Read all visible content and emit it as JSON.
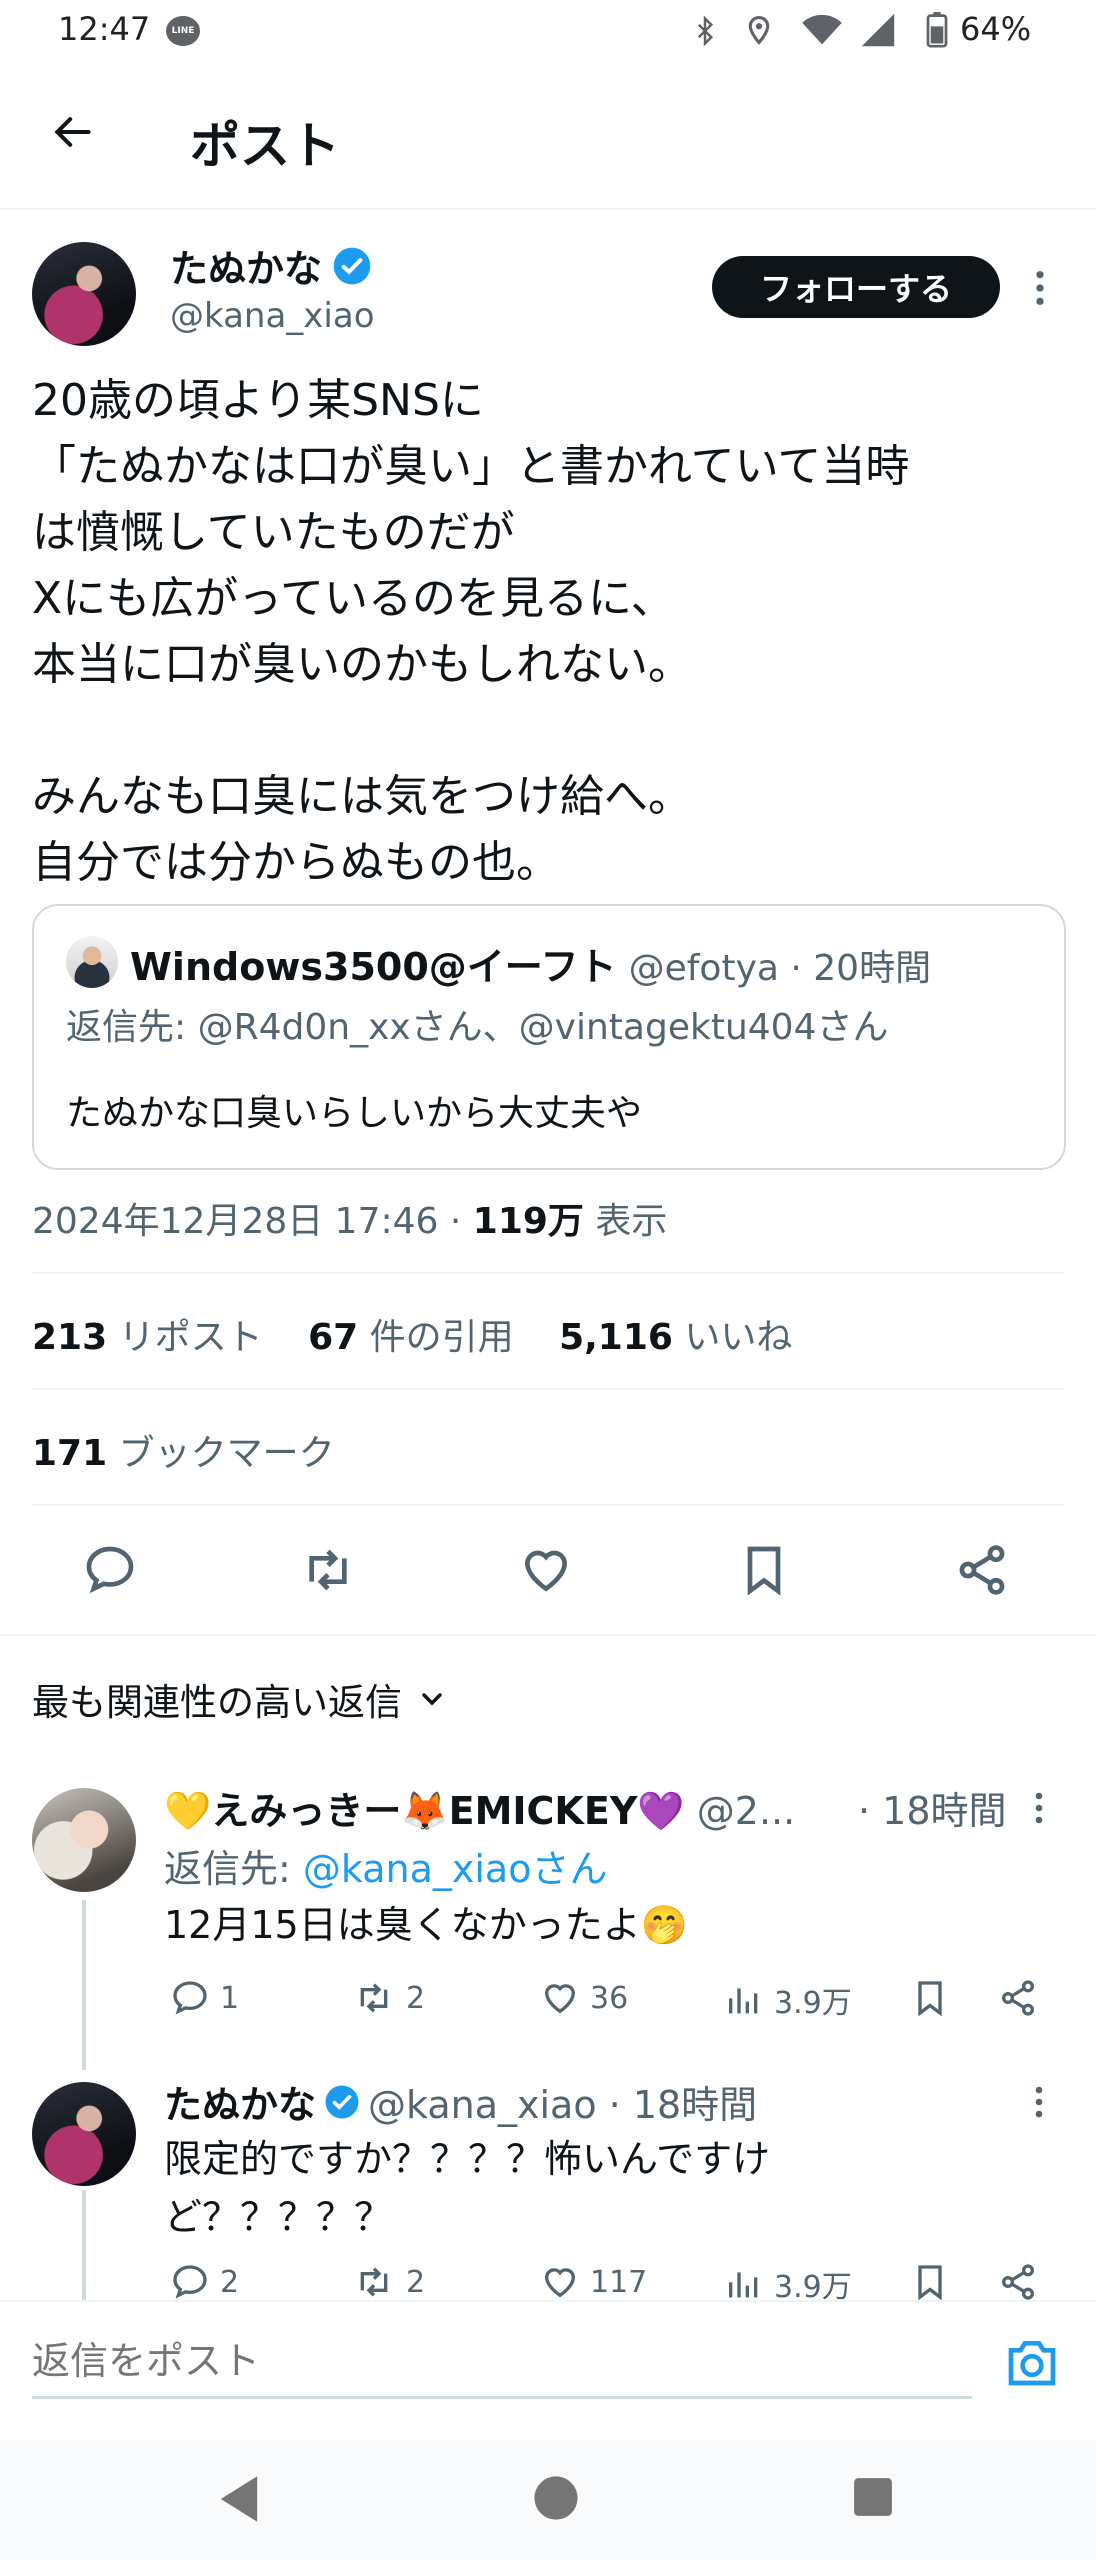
{
  "status_bar": {
    "time": "12:47",
    "app_badge": "LINE",
    "battery": "64%"
  },
  "header": {
    "title": "ポスト"
  },
  "post": {
    "author_name": "たぬかな",
    "author_handle": "@kana_xiao",
    "follow_label": "フォローする",
    "text": "20歳の頃より某SNSに\n「たぬかなは口が臭い」と書かれていて当時\nは憤慨していたものだが\nXにも広がっているのを見るに、\n本当に口が臭いのかもしれない。\n\nみんなも口臭には気をつけ給へ。\n自分では分からぬもの也。",
    "quote": {
      "author_name": "Windows3500@イーフト",
      "meta": "@efotya · 20時間",
      "reply_prefix": "返信先: ",
      "reply_to": "@R4d0n_xxさん、@vintagektu404さん",
      "text": "たぬかな口臭いらしいから大丈夫や"
    },
    "datetime": "2024年12月28日 17:46 · ",
    "views_count": "119万",
    "views_label": " 表示",
    "stats": {
      "reposts_count": "213",
      "reposts_label": " リポスト",
      "quotes_count": "67",
      "quotes_label": " 件の引用",
      "likes_count": "5,116",
      "likes_label": " いいね",
      "bookmarks_count": "171",
      "bookmarks_label": " ブックマーク"
    }
  },
  "replies_header": {
    "label": "最も関連性の高い返信"
  },
  "replies": [
    {
      "author_name": "💛えみっきー🦊EMICKEY💜",
      "handle": "@2...",
      "time": "· 18時間",
      "reply_prefix": "返信先: ",
      "reply_to": "@kana_xiaoさん",
      "text": "12月15日は臭くなかったよ🤭",
      "replies": "1",
      "reposts": "2",
      "likes": "36",
      "views": "3.9万"
    },
    {
      "author_name": "たぬかな",
      "handle": "@kana_xiao · 18時間",
      "text": "限定的ですか？？？？怖いんですけ\nど？？？？？",
      "replies": "2",
      "reposts": "2",
      "likes": "117",
      "views": "3.9万"
    }
  ],
  "compose": {
    "placeholder": "返信をポスト"
  },
  "colors": {
    "accent": "#1d9bf0",
    "text": "#0f1419",
    "muted": "#536471",
    "border": "#eff3f4"
  }
}
